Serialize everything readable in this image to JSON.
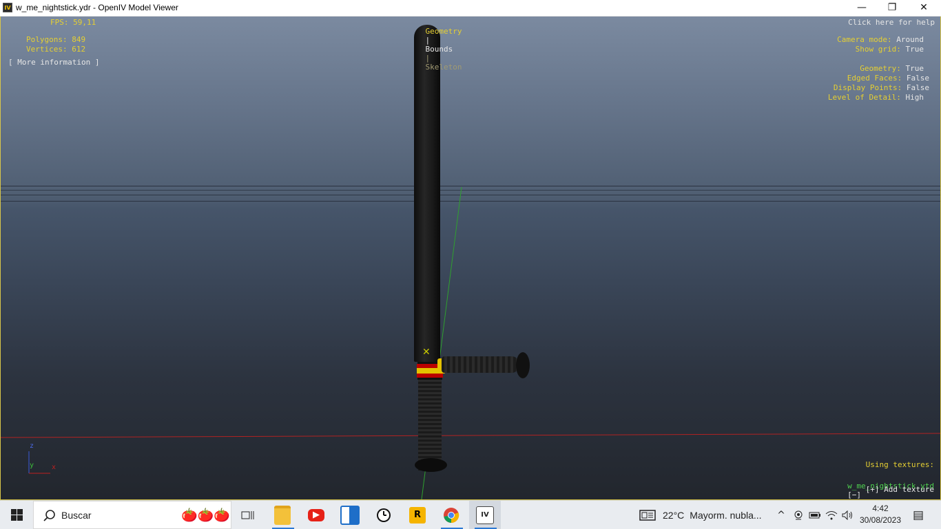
{
  "window": {
    "title": "w_me_nightstick.ydr - OpenIV Model Viewer",
    "app_icon_label": "IV",
    "minimize": "—",
    "maximize": "❐",
    "close": "✕"
  },
  "stats": {
    "fps_label": "FPS:",
    "fps_value": "59,11",
    "polygons_label": "Polygons:",
    "polygons_value": "849",
    "vertices_label": "Vertices:",
    "vertices_value": "612",
    "more_info": "[ More information ]"
  },
  "view_tabs": {
    "geometry": "Geometry",
    "sep1": "|",
    "bounds": "Bounds",
    "sep2": "|",
    "skeleton": "Skeleton"
  },
  "help_link": "Click here for help",
  "settings": {
    "camera_mode_label": "Camera mode:",
    "camera_mode_value": "Around",
    "show_grid_label": "Show grid:",
    "show_grid_value": "True",
    "geometry_label": "Geometry:",
    "geometry_value": "True",
    "edged_faces_label": "Edged Faces:",
    "edged_faces_value": "False",
    "display_points_label": "Display Points:",
    "display_points_value": "False",
    "lod_label": "Level of Detail:",
    "lod_value": "High"
  },
  "axis_gizmo": {
    "z": "z",
    "y": "y",
    "x": "x"
  },
  "textures": {
    "heading": "Using textures:",
    "file": "w_me_nightstick.ytd",
    "remove": "[−]",
    "add": "[+] Add texture"
  },
  "taskbar": {
    "search_placeholder": "Buscar",
    "search_decor": "🍅🍅🍅",
    "weather_temp": "22°C",
    "weather_text": "Mayorm. nubla...",
    "time": "4:42",
    "date": "30/08/2023",
    "chevron": "^",
    "notification": "▤"
  }
}
